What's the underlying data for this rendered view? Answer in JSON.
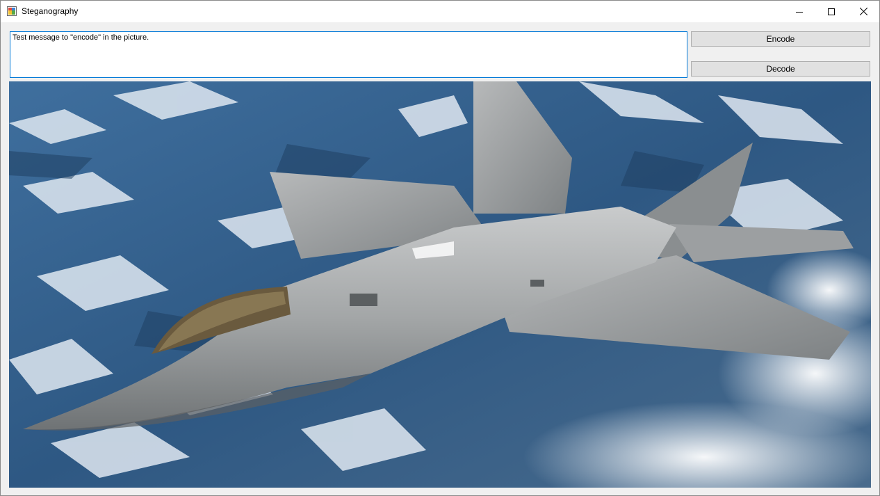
{
  "window": {
    "title": "Steganography",
    "app_icon": "winforms-app-icon",
    "controls": {
      "minimize": "minimize-icon",
      "maximize": "maximize-icon",
      "close": "close-icon"
    }
  },
  "message": {
    "text": "Test message to \"encode\" in the picture."
  },
  "buttons": {
    "encode_label": "Encode",
    "decode_label": "Decode"
  },
  "picture": {
    "subject": "fighter-jet-over-snowy-mountains"
  },
  "colors": {
    "focus_border": "#0078d7",
    "button_face": "#e1e1e1",
    "window_bg": "#f0f0f0"
  }
}
